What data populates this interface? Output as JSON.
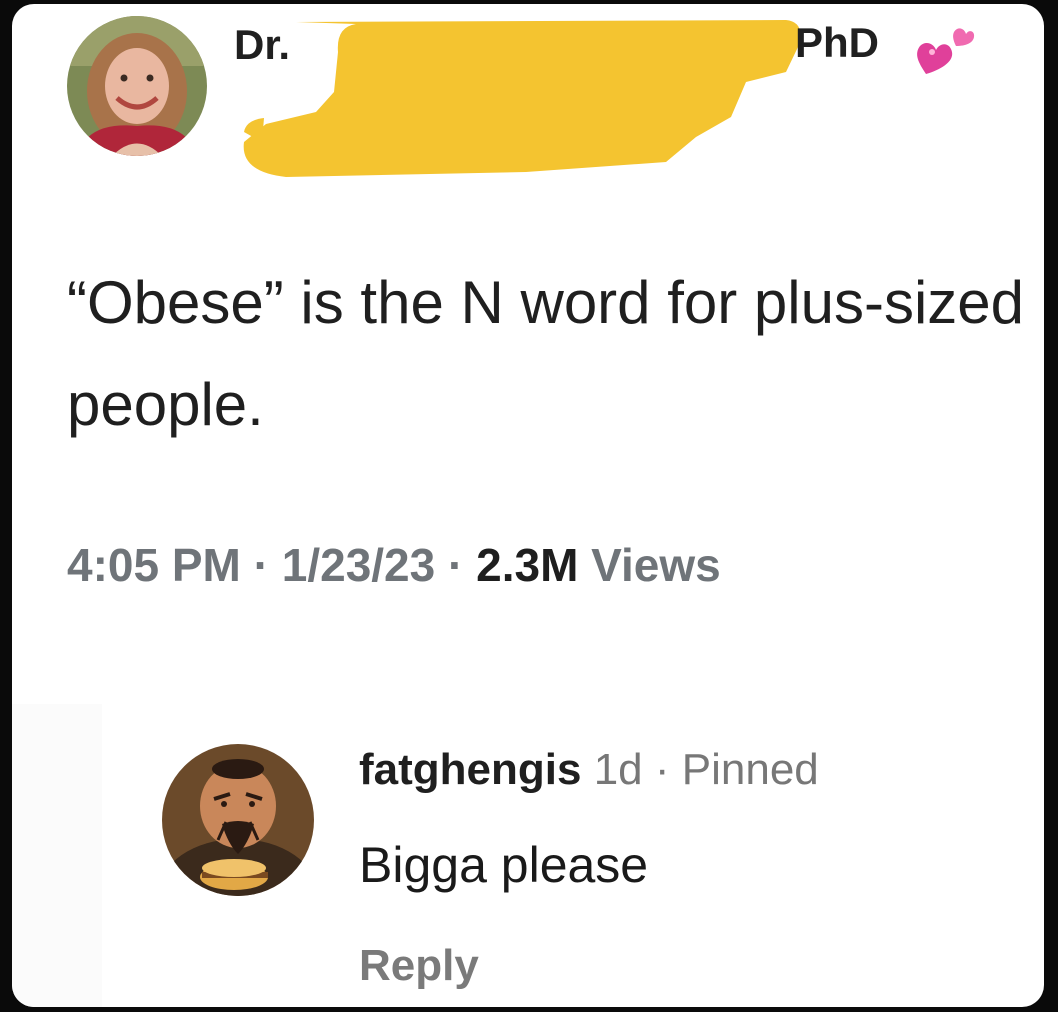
{
  "tweet": {
    "author_prefix": "Dr.",
    "author_suffix": "PhD",
    "badge_icon": "two-hearts-icon",
    "text": "“Obese” is the N word for plus-sized people.",
    "time": "4:05 PM",
    "date": "1/23/23",
    "views_count": "2.3M",
    "views_label": "Views",
    "separator": "·"
  },
  "redaction": {
    "color": "#f4c430"
  },
  "comment": {
    "username": "fatghengis",
    "age": "1d",
    "separator": "·",
    "pinned_label": "Pinned",
    "text": "Bigga please",
    "reply_label": "Reply"
  }
}
